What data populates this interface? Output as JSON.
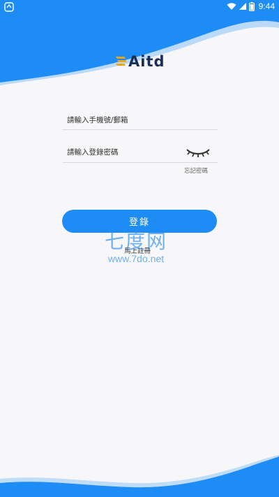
{
  "status_bar": {
    "time": "9:44"
  },
  "logo": {
    "text": "Aitd"
  },
  "form": {
    "phone_placeholder": "請輸入手機號/郵箱",
    "password_placeholder": "請輸入登錄密碼",
    "forgot_label": "忘記密碼",
    "login_label": "登錄",
    "register_label": "馬上註冊"
  },
  "watermark": {
    "main": "七度网",
    "url": "www.7do.net"
  },
  "colors": {
    "primary": "#1e8cf5",
    "background": "#f7f7f9"
  }
}
